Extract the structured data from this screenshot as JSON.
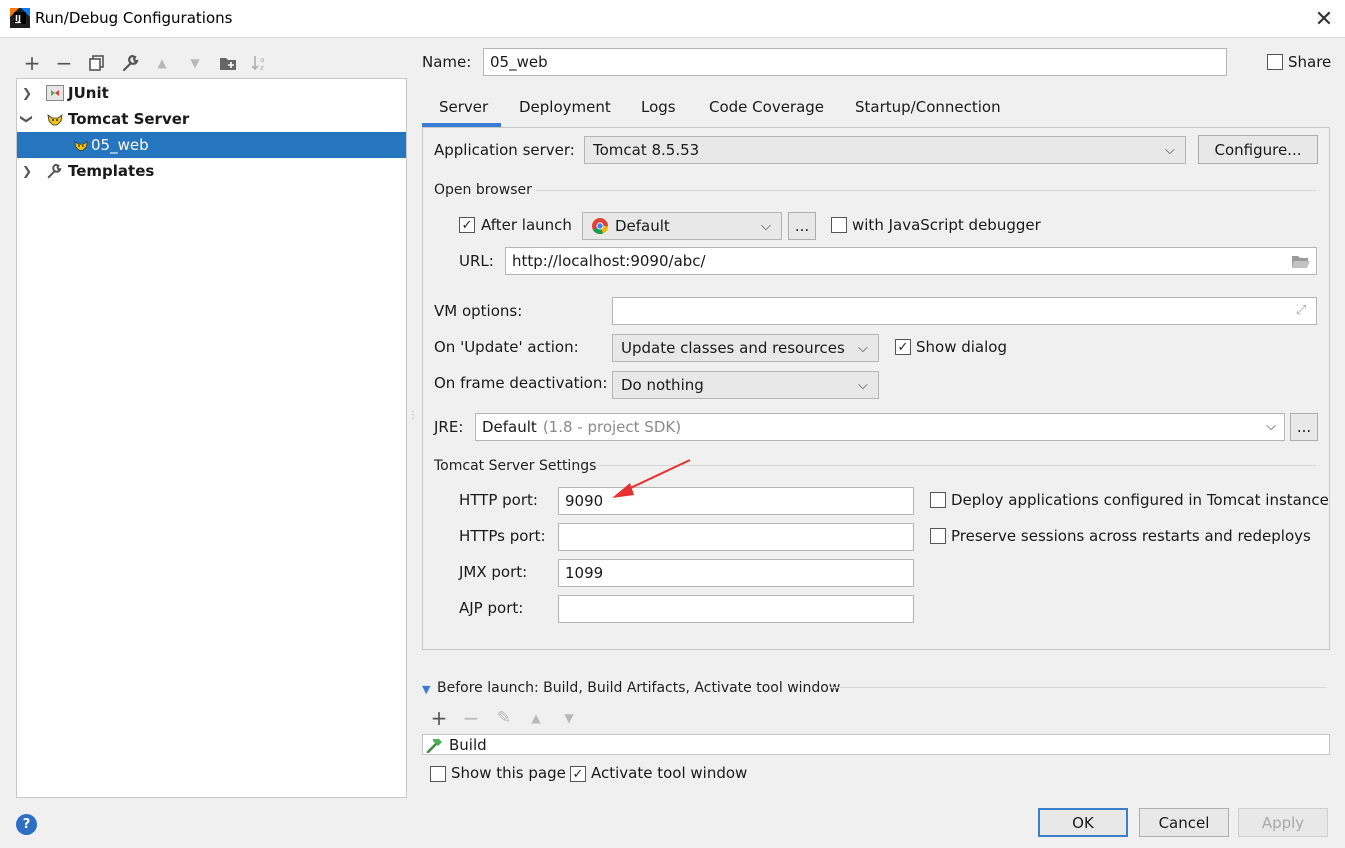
{
  "window": {
    "title": "Run/Debug Configurations",
    "close_glyph": "✕"
  },
  "toolbar": {
    "add": "+",
    "remove": "−",
    "copy": "⧉",
    "edit": "🔧",
    "up": "▲",
    "down": "▼",
    "folder": "📁",
    "sort": "↓ᵃz"
  },
  "tree": {
    "items": [
      {
        "label": "JUnit",
        "icon": "junit-icon",
        "expanded": false
      },
      {
        "label": "Tomcat Server",
        "icon": "tomcat-icon",
        "expanded": true
      },
      {
        "label": "05_web",
        "icon": "tomcat-icon",
        "selected": true
      },
      {
        "label": "Templates",
        "icon": "wrench-icon",
        "expanded": false
      }
    ]
  },
  "name": {
    "label": "Name:",
    "value": "05_web"
  },
  "share": {
    "label": "Share",
    "checked": false
  },
  "tabs": [
    "Server",
    "Deployment",
    "Logs",
    "Code Coverage",
    "Startup/Connection"
  ],
  "server": {
    "app_server_label": "Application server:",
    "app_server_value": "Tomcat 8.5.53",
    "configure_label": "Configure...",
    "open_browser_title": "Open browser",
    "after_launch_label": "After launch",
    "after_launch_checked": true,
    "browser_value": "Default",
    "ellipsis": "...",
    "js_debugger_label": "with JavaScript debugger",
    "js_debugger_checked": false,
    "url_label": "URL:",
    "url_value": "http://localhost:9090/abc/",
    "vm_options_label": "VM options:",
    "vm_options_value": "",
    "on_update_label": "On 'Update' action:",
    "on_update_value": "Update classes and resources",
    "show_dialog_label": "Show dialog",
    "show_dialog_checked": true,
    "on_frame_label": "On frame deactivation:",
    "on_frame_value": "Do nothing",
    "jre_label": "JRE:",
    "jre_value": "Default",
    "jre_hint": "(1.8 - project SDK)",
    "tomcat_settings_title": "Tomcat Server Settings",
    "http_port_label": "HTTP port:",
    "http_port_value": "9090",
    "https_port_label": "HTTPs port:",
    "https_port_value": "",
    "jmx_port_label": "JMX port:",
    "jmx_port_value": "1099",
    "ajp_port_label": "AJP port:",
    "ajp_port_value": "",
    "deploy_apps_label": "Deploy applications configured in Tomcat instance",
    "deploy_apps_checked": false,
    "preserve_sessions_label": "Preserve sessions across restarts and redeploys",
    "preserve_sessions_checked": false
  },
  "before_launch": {
    "title": "Before launch: Build, Build Artifacts, Activate tool window",
    "add": "+",
    "remove": "−",
    "edit": "✎",
    "up": "▲",
    "down": "▼",
    "items": [
      "Build"
    ],
    "show_page_label": "Show this page",
    "show_page_checked": false,
    "activate_tool_label": "Activate tool window",
    "activate_tool_checked": true
  },
  "footer": {
    "help": "?",
    "ok": "OK",
    "cancel": "Cancel",
    "apply": "Apply"
  },
  "colors": {
    "selection": "#2675bf",
    "accent": "#3a7bd5",
    "arrow_annotation": "#e8312f"
  }
}
